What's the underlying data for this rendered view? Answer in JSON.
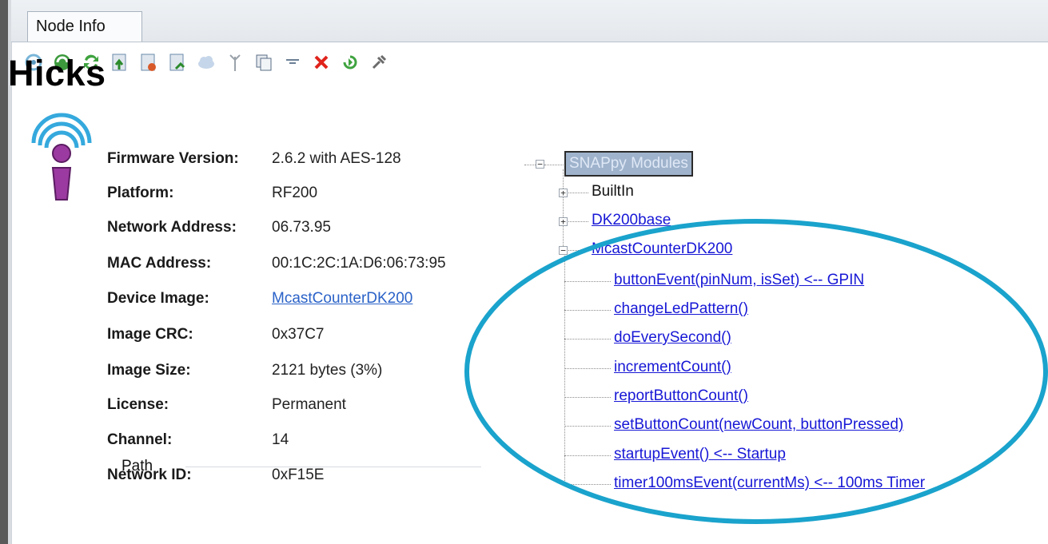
{
  "tab": {
    "label": "Node Info"
  },
  "toolbar": {
    "icons": [
      "refresh-icon",
      "ping-icon",
      "sync-icon",
      "upload-image-icon",
      "erase-image-icon",
      "image-info-icon",
      "cloud-icon",
      "antenna-icon",
      "copy-icon",
      "text-icon",
      "delete-icon",
      "run-icon",
      "settings-icon"
    ]
  },
  "node": {
    "name": "Hicks",
    "fields": [
      {
        "label": "Firmware Version:",
        "value": "2.6.2 with AES-128"
      },
      {
        "label": "Platform:",
        "value": "RF200"
      },
      {
        "label": "Network Address:",
        "value": "06.73.95"
      },
      {
        "label": "MAC Address:",
        "value": "00:1C:2C:1A:D6:06:73:95"
      },
      {
        "label": "Device Image:",
        "value": "McastCounterDK200"
      },
      {
        "label": "Image CRC:",
        "value": "0x37C7"
      },
      {
        "label": "Image Size:",
        "value": "2121 bytes (3%)"
      },
      {
        "label": "License:",
        "value": "Permanent"
      },
      {
        "label": "Channel:",
        "value": "14"
      },
      {
        "label": "Network ID:",
        "value": "0xF15E"
      }
    ],
    "path_label": "Path"
  },
  "tree": {
    "root": "SNAPpy Modules",
    "modules": [
      {
        "name": "BuiltIn",
        "expanded": false
      },
      {
        "name": "DK200base",
        "expanded": false
      },
      {
        "name": "McastCounterDK200",
        "expanded": true
      }
    ],
    "functions": [
      "buttonEvent(pinNum, isSet) <-- GPIN",
      "changeLedPattern()",
      "doEverySecond()",
      "incrementCount()",
      "reportButtonCount()",
      "setButtonCount(newCount, buttonPressed)",
      "startupEvent() <-- Startup",
      "timer100msEvent(currentMs) <-- 100ms Timer"
    ]
  },
  "colors": {
    "highlight_ellipse": "#1aa3cc",
    "link": "#1717d6",
    "icon_purple": "#8a2d8f",
    "icon_blue": "#35a9dd"
  }
}
